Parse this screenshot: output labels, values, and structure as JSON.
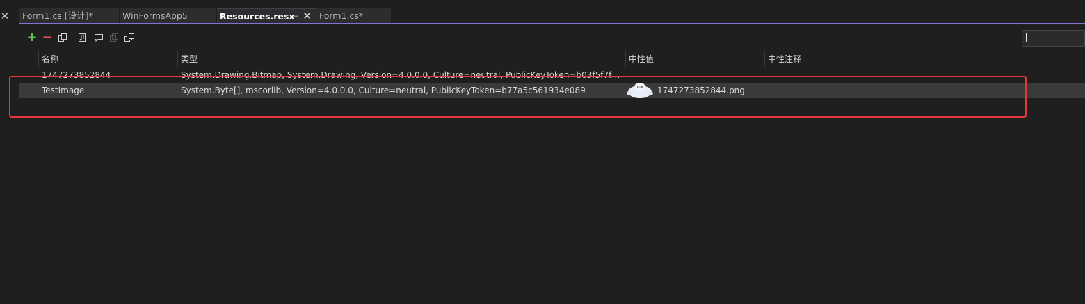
{
  "tabs": [
    {
      "label": "Form1.cs [设计]*"
    },
    {
      "label": "WinFormsApp5"
    },
    {
      "label": "Resources.resx",
      "pin": "⊣",
      "close": "✕"
    },
    {
      "label": "Form1.cs*"
    }
  ],
  "left_close": "✕",
  "toolbar": {
    "add_icon": "+",
    "remove_icon": "−"
  },
  "search": {
    "value": ""
  },
  "columns": {
    "name": "名称",
    "type": "类型",
    "neutral_value": "中性值",
    "neutral_comment": "中性注释"
  },
  "rows": [
    {
      "name": "1747273852844",
      "type": "System.Drawing.Bitmap, System.Drawing, Version=4.0.0.0, Culture=neutral, PublicKeyToken=b03f5f7f11d50...",
      "value": "",
      "comment": ""
    },
    {
      "name": "TestImage",
      "type": "System.Byte[], mscorlib, Version=4.0.0.0, Culture=neutral, PublicKeyToken=b77a5c561934e089",
      "value": "1747273852844.png",
      "comment": ""
    }
  ],
  "colors": {
    "accent": "#8c6fd6",
    "add": "#5fbf4f",
    "remove": "#e05252",
    "highlight": "#e8373c"
  }
}
